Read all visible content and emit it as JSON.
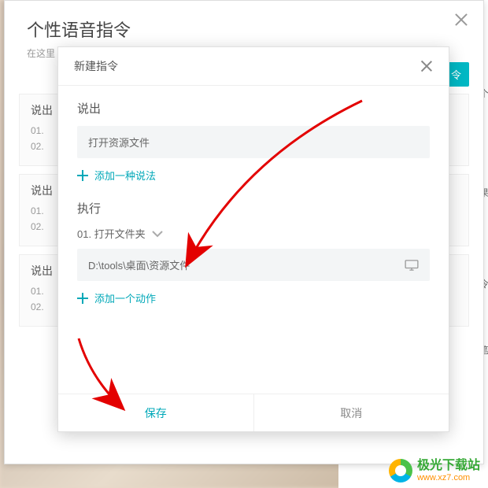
{
  "outer": {
    "title": "个性语音指令",
    "subtitle": "在这里",
    "close_name": "close",
    "teal_btn": "令"
  },
  "bg_rows": [
    {
      "label": "说出",
      "l1": "01.",
      "l2": "02."
    },
    {
      "label": "说出",
      "l1": "01.",
      "l2": "02."
    },
    {
      "label": "说出",
      "l1": "01.",
      "l2": "02."
    }
  ],
  "side": {
    "a": "个",
    "b": "果",
    "c": "需令",
    "d": "笔"
  },
  "inner": {
    "title": "新建指令",
    "say": {
      "label": "说出",
      "input_value": "打开资源文件",
      "add_label": "添加一种说法"
    },
    "exec": {
      "label": "执行",
      "step": "01.  打开文件夹",
      "path": "D:\\tools\\桌面\\资源文件",
      "add_label": "添加一个动作"
    },
    "footer": {
      "save": "保存",
      "cancel": "取消"
    }
  },
  "brand": {
    "name": "极光下载站",
    "url": "www.xz7.com"
  }
}
